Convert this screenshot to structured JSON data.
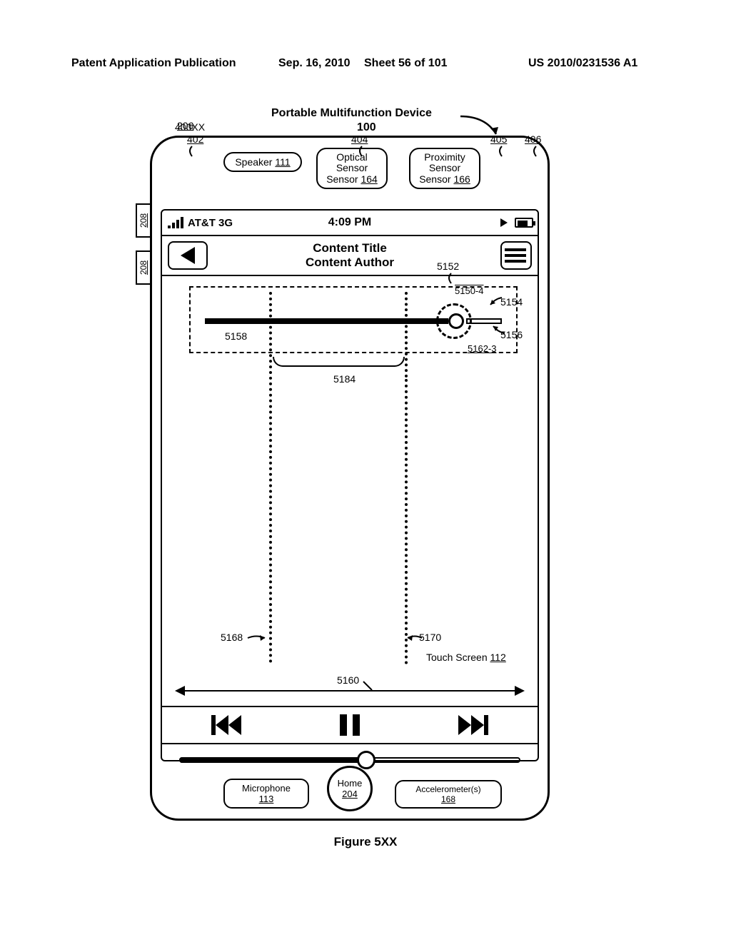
{
  "header": {
    "left": "Patent Application Publication",
    "date": "Sep. 16, 2010",
    "sheet": "Sheet 56 of 101",
    "pubno": "US 2010/0231536 A1"
  },
  "device": {
    "title": "Portable Multifunction Device",
    "number": "100",
    "ref206": "206",
    "ref208": "208",
    "speaker": {
      "label": "Speaker",
      "ref": "111"
    },
    "optical": {
      "label": "Optical Sensor",
      "ref": "164"
    },
    "proximity": {
      "label": "Proximity Sensor",
      "ref": "166"
    },
    "microphone": {
      "label": "Microphone",
      "ref": "113"
    },
    "home": {
      "label": "Home",
      "ref": "204"
    },
    "accel": {
      "label": "Accelerometer(s)",
      "ref": "168"
    },
    "touchscreen": {
      "label": "Touch Screen",
      "ref": "112"
    }
  },
  "refs": {
    "r400xx": "400XX",
    "r402": "402",
    "r404": "404",
    "r405": "405",
    "r406": "406",
    "r5152": "5152",
    "r5150_4": "5150-4",
    "r5154": "5154",
    "r5156": "5156",
    "r5158": "5158",
    "r5162_3": "5162-3",
    "r5168": "5168",
    "r5170": "5170",
    "r5184": "5184",
    "r5160": "5160"
  },
  "status": {
    "carrier": "AT&T 3G",
    "time": "4:09 PM"
  },
  "content": {
    "title": "Content Title",
    "author": "Content Author"
  },
  "figure": "Figure 5XX"
}
